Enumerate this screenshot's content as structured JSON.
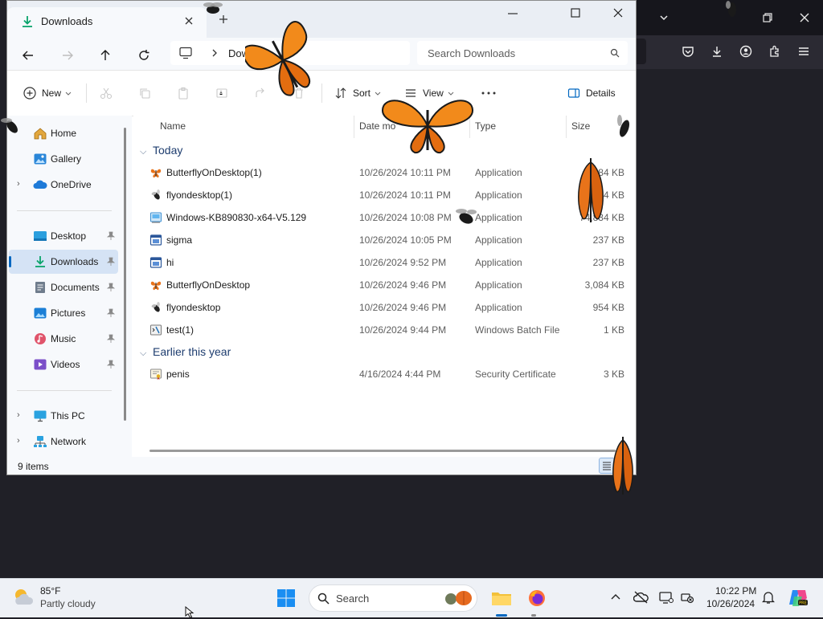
{
  "window": {
    "tab_title": "Downloads",
    "address_crumb": "Downl",
    "search_placeholder": "Search Downloads"
  },
  "commands": {
    "new": "New",
    "sort": "Sort",
    "view": "View",
    "details": "Details"
  },
  "sidebar": {
    "items": [
      {
        "label": "Home",
        "icon": "home-icon"
      },
      {
        "label": "Gallery",
        "icon": "gallery-icon"
      },
      {
        "label": "OneDrive",
        "icon": "cloud-icon"
      },
      {
        "label": "Desktop",
        "icon": "desktop-folder-icon"
      },
      {
        "label": "Downloads",
        "icon": "download-folder-icon"
      },
      {
        "label": "Documents",
        "icon": "documents-folder-icon"
      },
      {
        "label": "Pictures",
        "icon": "pictures-folder-icon"
      },
      {
        "label": "Music",
        "icon": "music-folder-icon"
      },
      {
        "label": "Videos",
        "icon": "videos-folder-icon"
      },
      {
        "label": "This PC",
        "icon": "pc-icon"
      },
      {
        "label": "Network",
        "icon": "network-icon"
      }
    ]
  },
  "columns": {
    "name": "Name",
    "date": "Date mo",
    "type": "Type",
    "size": "Size"
  },
  "groups": [
    {
      "label": "Today",
      "rows": [
        {
          "name": "ButterflyOnDesktop(1)",
          "date": "10/26/2024 10:11 PM",
          "type": "Application",
          "size": "3,084 KB",
          "icon": "butterfly-app-icon"
        },
        {
          "name": "flyondesktop(1)",
          "date": "10/26/2024 10:11 PM",
          "type": "Application",
          "size": "954 KB",
          "icon": "fly-app-icon"
        },
        {
          "name": "Windows-KB890830-x64-V5.129",
          "date": "10/26/2024 10:08 PM",
          "type": "Application",
          "size": "74,834 KB",
          "icon": "installer-icon"
        },
        {
          "name": "sigma",
          "date": "10/26/2024 10:05 PM",
          "type": "Application",
          "size": "237 KB",
          "icon": "app-window-icon"
        },
        {
          "name": "hi",
          "date": "10/26/2024 9:52 PM",
          "type": "Application",
          "size": "237 KB",
          "icon": "app-window-icon"
        },
        {
          "name": "ButterflyOnDesktop",
          "date": "10/26/2024 9:46 PM",
          "type": "Application",
          "size": "3,084 KB",
          "icon": "butterfly-app-icon"
        },
        {
          "name": "flyondesktop",
          "date": "10/26/2024 9:46 PM",
          "type": "Application",
          "size": "954 KB",
          "icon": "fly-app-icon"
        },
        {
          "name": "test(1)",
          "date": "10/26/2024 9:44 PM",
          "type": "Windows Batch File",
          "size": "1 KB",
          "icon": "batch-file-icon"
        }
      ]
    },
    {
      "label": "Earlier this year",
      "rows": [
        {
          "name": "penis",
          "date": "4/16/2024 4:44 PM",
          "type": "Security Certificate",
          "size": "3 KB",
          "icon": "certificate-icon"
        }
      ]
    }
  ],
  "status": {
    "item_count": "9 items"
  },
  "taskbar": {
    "weather_temp": "85°F",
    "weather_desc": "Partly cloudy",
    "search_placeholder": "Search",
    "time": "10:22 PM",
    "date": "10/26/2024"
  },
  "colors": {
    "accent": "#0067c0",
    "selection": "#d5e3f5",
    "group_header": "#1e3d6f",
    "butterfly_orange": "#f07a14",
    "taskbar": "#eef1f6",
    "browser_dark": "#2b2a33"
  }
}
